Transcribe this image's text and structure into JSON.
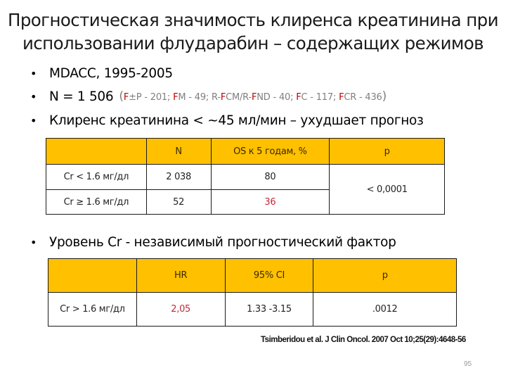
{
  "slide": {
    "title_lines": [
      "Прогностическая значимость клиренса креатинина при",
      "использовании флударабин – содержащих режимов"
    ],
    "bullets": [
      {
        "text": "MDACC, 1995-2005"
      },
      {
        "text": "N = 1 506",
        "detail": {
          "open": "(",
          "parts": [
            {
              "f": "F",
              "rest": "±P - 201; "
            },
            {
              "f": "F",
              "rest": "M - 49; R-"
            },
            {
              "f": "F",
              "rest": "CM/R-"
            },
            {
              "f": "F",
              "rest": "ND - 40; "
            },
            {
              "f": "F",
              "rest": "C - 117; "
            },
            {
              "f": "F",
              "rest": "CR - 436"
            }
          ],
          "close": ")"
        }
      },
      {
        "text": "Клиренс креатинина < ~45 мл/мин – ухудшает прогноз"
      },
      {
        "text": "Уровень Cr - независимый прогностический фактор"
      }
    ],
    "bullet_glyph": "•",
    "table1": {
      "headers": [
        "",
        "N",
        "OS к 5 годам, %",
        "p"
      ],
      "rows": [
        {
          "label": "Cr < 1.6 мг/дл",
          "n": "2 038",
          "os": "80"
        },
        {
          "label": "Cr ≥ 1.6 мг/дл",
          "n": "52",
          "os": "36"
        }
      ],
      "p_value": "< 0,0001"
    },
    "table2": {
      "headers": [
        "",
        "HR",
        "95% CI",
        "p"
      ],
      "rows": [
        {
          "label": "Cr > 1.6 мг/дл",
          "hr": "2,05",
          "ci": "1.33 -3.15",
          "p": ".0012"
        }
      ]
    },
    "citation": "Tsimberidou et al. J Clin Oncol. 2007 Oct 10;25(29):4648-56",
    "page_number": "95",
    "colors": {
      "header_fill": "#ffc000",
      "highlight_red": "#c0283c",
      "fludarabine_red": "#c00000",
      "detail_gray": "#7f7f7f"
    }
  }
}
